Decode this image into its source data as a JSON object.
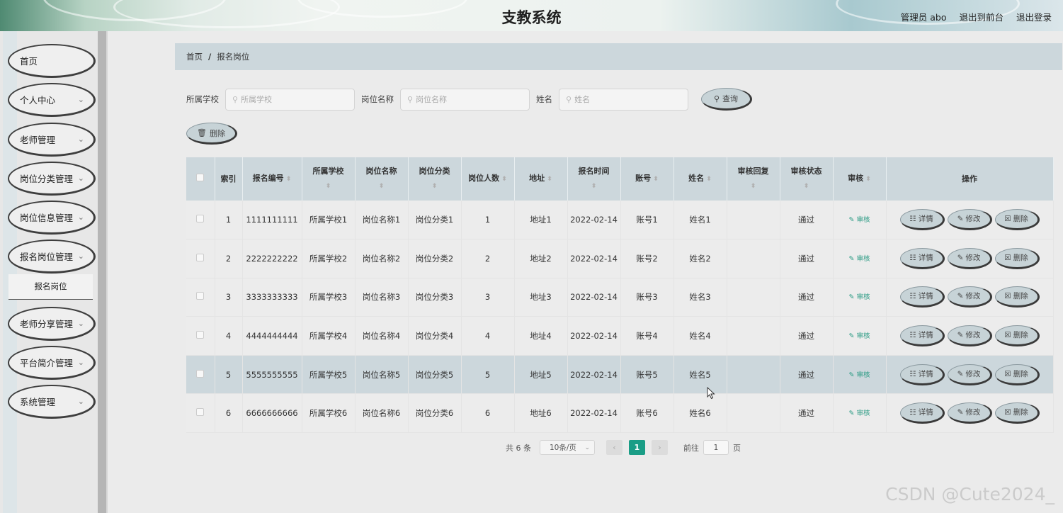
{
  "header": {
    "title": "支教系统",
    "admin_label": "管理员 abo",
    "to_front": "退出到前台",
    "logout": "退出登录"
  },
  "menu": {
    "items": [
      {
        "label": "首页",
        "chevron": false
      },
      {
        "label": "个人中心",
        "chevron": true
      },
      {
        "label": "老师管理",
        "chevron": true
      },
      {
        "label": "岗位分类管理",
        "chevron": true
      },
      {
        "label": "岗位信息管理",
        "chevron": true
      },
      {
        "label": "报名岗位管理",
        "chevron": true
      },
      {
        "label": "老师分享管理",
        "chevron": true
      },
      {
        "label": "平台简介管理",
        "chevron": true
      },
      {
        "label": "系统管理",
        "chevron": true
      }
    ],
    "submenu_label": "报名岗位"
  },
  "breadcrumb": {
    "home": "首页",
    "sep": "/",
    "current": "报名岗位"
  },
  "search": {
    "school_label": "所属学校",
    "school_placeholder": "所属学校",
    "post_label": "岗位名称",
    "post_placeholder": "岗位名称",
    "name_label": "姓名",
    "name_placeholder": "姓名",
    "query_btn": "查询"
  },
  "toolbar": {
    "delete_btn": "删除"
  },
  "table": {
    "headers": [
      "索引",
      "报名编号",
      "所属学校",
      "岗位名称",
      "岗位分类",
      "岗位人数",
      "地址",
      "报名时间",
      "账号",
      "姓名",
      "审核回复",
      "审核状态",
      "审核",
      "操作"
    ],
    "rows": [
      [
        "1",
        "1111111111",
        "所属学校1",
        "岗位名称1",
        "岗位分类1",
        "1",
        "地址1",
        "2022-02-14",
        "账号1",
        "姓名1",
        "",
        "通过"
      ],
      [
        "2",
        "2222222222",
        "所属学校2",
        "岗位名称2",
        "岗位分类2",
        "2",
        "地址2",
        "2022-02-14",
        "账号2",
        "姓名2",
        "",
        "通过"
      ],
      [
        "3",
        "3333333333",
        "所属学校3",
        "岗位名称3",
        "岗位分类3",
        "3",
        "地址3",
        "2022-02-14",
        "账号3",
        "姓名3",
        "",
        "通过"
      ],
      [
        "4",
        "4444444444",
        "所属学校4",
        "岗位名称4",
        "岗位分类4",
        "4",
        "地址4",
        "2022-02-14",
        "账号4",
        "姓名4",
        "",
        "通过"
      ],
      [
        "5",
        "5555555555",
        "所属学校5",
        "岗位名称5",
        "岗位分类5",
        "5",
        "地址5",
        "2022-02-14",
        "账号5",
        "姓名5",
        "",
        "通过"
      ],
      [
        "6",
        "6666666666",
        "所属学校6",
        "岗位名称6",
        "岗位分类6",
        "6",
        "地址6",
        "2022-02-14",
        "账号6",
        "姓名6",
        "",
        "通过"
      ]
    ],
    "audit_link": "审核",
    "op_detail": "详情",
    "op_edit": "修改",
    "op_delete": "删除",
    "highlight_row": 5
  },
  "pagination": {
    "total_text": "共 6 条",
    "page_size": "10条/页",
    "current_page": "1",
    "goto_label": "前往",
    "goto_value": "1",
    "page_suffix": "页"
  },
  "watermark": "CSDN @Cute2024_",
  "colors": {
    "accent": "#1a9d86",
    "header_bg": "#ccd7dc",
    "audit": "#2b9b84"
  }
}
